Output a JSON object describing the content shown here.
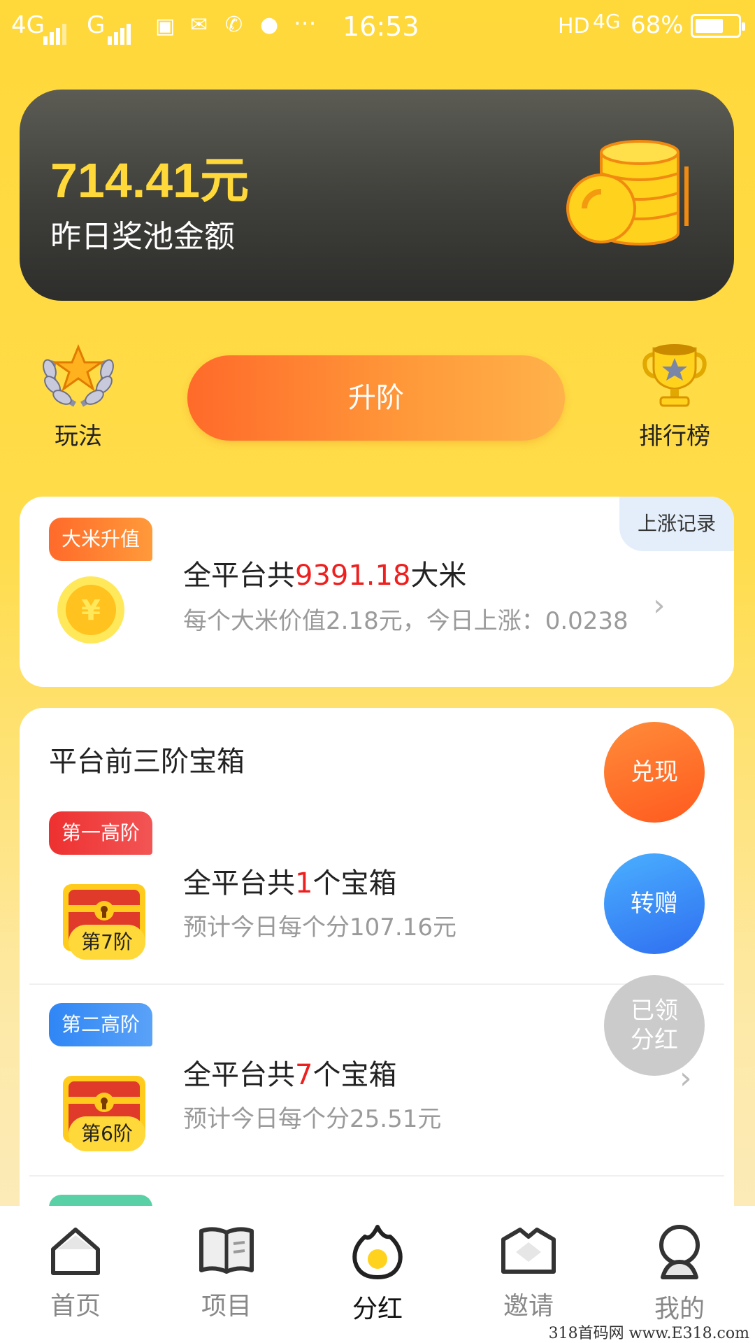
{
  "status_bar": {
    "net1": "4G",
    "net2": "G",
    "time": "16:53",
    "net3": "HD",
    "net4": "4G",
    "battery": "68%",
    "battery_level": 0.68
  },
  "pool": {
    "amount": "714.41元",
    "label": "昨日奖池金额"
  },
  "actions": {
    "rules_label": "玩法",
    "upgrade_label": "升阶",
    "rank_label": "排行榜"
  },
  "rice": {
    "badge": "大米升值",
    "history": "上涨记录",
    "coin_symbol": "¥",
    "title_pre": "全平台共",
    "title_value": "9391.18",
    "title_post": "大米",
    "sub": "每个大米价值2.18元，今日上涨：0.0238"
  },
  "chests": {
    "heading": "平台前三阶宝箱",
    "tiers": [
      {
        "badge": "第一高阶",
        "level": "第7阶",
        "title_pre": "全平台共",
        "title_value": "1",
        "title_post": "个宝箱",
        "sub": "预计今日每个分107.16元",
        "color": "#ee3a3a"
      },
      {
        "badge": "第二高阶",
        "level": "第6阶",
        "title_pre": "全平台共",
        "title_value": "7",
        "title_post": "个宝箱",
        "sub": "预计今日每个分25.51元",
        "color": "#3a8ef6"
      }
    ],
    "cash_button": "兑现",
    "gift_button": "转赠",
    "claimed_button_line1": "已领",
    "claimed_button_line2": "分红"
  },
  "nav": {
    "items": [
      {
        "label": "首页",
        "icon": "home-icon"
      },
      {
        "label": "项目",
        "icon": "book-icon"
      },
      {
        "label": "分红",
        "icon": "flame-icon"
      },
      {
        "label": "邀请",
        "icon": "envelope-icon"
      },
      {
        "label": "我的",
        "icon": "user-icon"
      }
    ],
    "active": "分红"
  },
  "watermark": "318首码网 www.E318.com"
}
